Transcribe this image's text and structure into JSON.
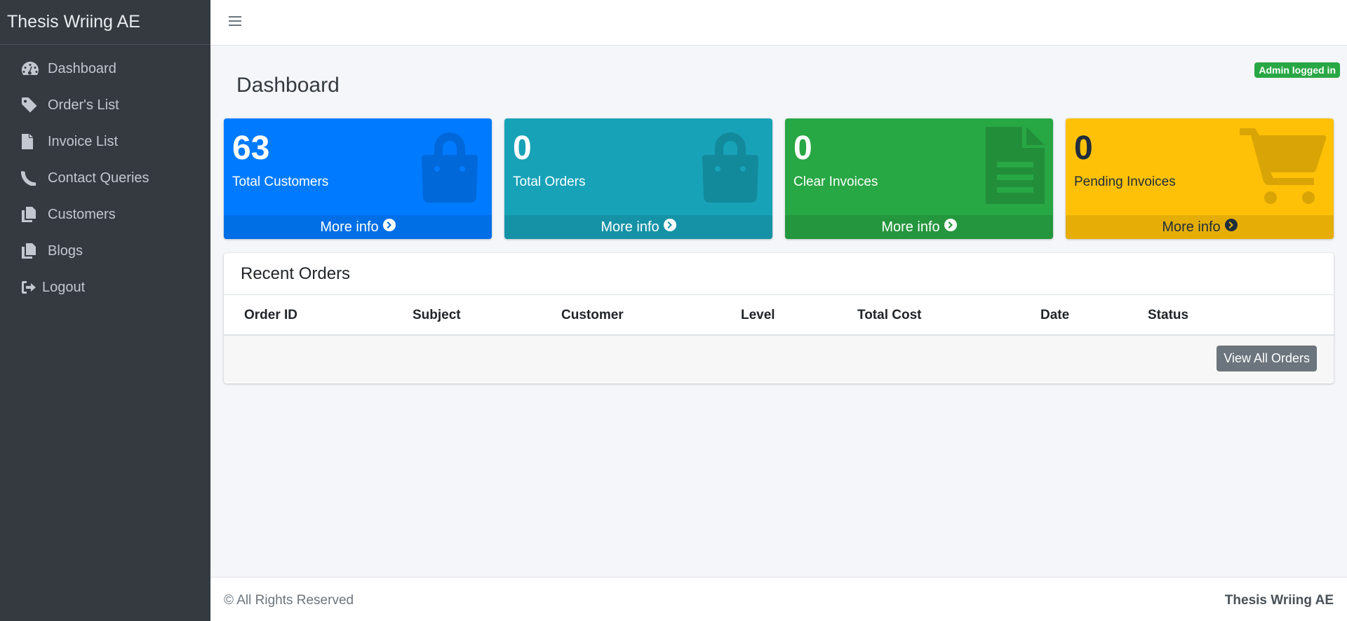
{
  "sidebar": {
    "brand": "Thesis Wriing AE",
    "items": [
      {
        "label": "Dashboard",
        "icon": "tachometer-icon"
      },
      {
        "label": "Order's List",
        "icon": "tag-icon"
      },
      {
        "label": "Invoice List",
        "icon": "file-icon"
      },
      {
        "label": "Contact Queries",
        "icon": "phone-icon"
      },
      {
        "label": "Customers",
        "icon": "copy-icon"
      },
      {
        "label": "Blogs",
        "icon": "copy-icon"
      },
      {
        "label": "Logout",
        "icon": "sign-out-icon"
      }
    ]
  },
  "header": {
    "menu_icon": "hamburger-icon"
  },
  "badge": "Admin logged in",
  "page_title": "Dashboard",
  "stats": [
    {
      "value": "63",
      "label": "Total Customers",
      "more": "More info",
      "icon": "shopping-bag-icon",
      "color": "#007bff"
    },
    {
      "value": "0",
      "label": "Total Orders",
      "more": "More info",
      "icon": "shopping-bag-icon",
      "color": "#17a2b8"
    },
    {
      "value": "0",
      "label": "Clear Invoices",
      "more": "More info",
      "icon": "document-icon",
      "color": "#28a745"
    },
    {
      "value": "0",
      "label": "Pending Invoices",
      "more": "More info",
      "icon": "cart-icon",
      "color": "#ffc107"
    }
  ],
  "recent_orders": {
    "title": "Recent Orders",
    "columns": [
      "Order ID",
      "Subject",
      "Customer",
      "Level",
      "Total Cost",
      "Date",
      "Status"
    ],
    "rows": [],
    "view_all": "View All Orders"
  },
  "footer": {
    "copyright": "© All Rights Reserved",
    "brand": "Thesis Wriing AE"
  }
}
